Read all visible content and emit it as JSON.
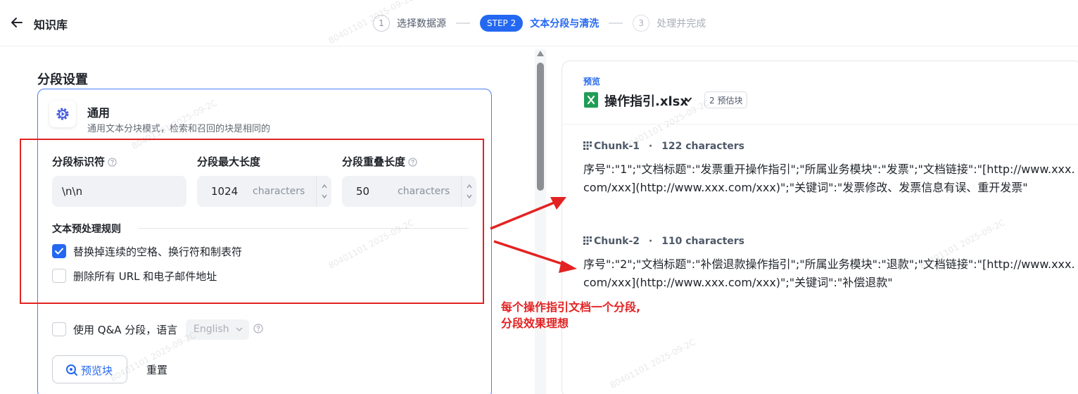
{
  "header": {
    "back_icon": "arrow-left-icon",
    "title": "知识库",
    "steps": [
      {
        "number": "1",
        "label": "选择数据源",
        "state": "done"
      },
      {
        "number": "STEP 2",
        "label": "文本分段与清洗",
        "state": "active"
      },
      {
        "number": "3",
        "label": "处理并完成",
        "state": "upcoming"
      }
    ]
  },
  "settings": {
    "title": "分段设置",
    "mode": {
      "name": "通用",
      "description": "通用文本分块模式，检索和召回的块是相同的",
      "icon": "gear-icon"
    },
    "fields": {
      "separator": {
        "label": "分段标识符",
        "value": "\\n\\n"
      },
      "max_length": {
        "label": "分段最大长度",
        "value": "1024",
        "unit": "characters"
      },
      "overlap": {
        "label": "分段重叠长度",
        "value": "50",
        "unit": "characters"
      }
    },
    "rules": {
      "title": "文本预处理规则",
      "items": [
        {
          "label": "替换掉连续的空格、换行符和制表符",
          "checked": true
        },
        {
          "label": "删除所有 URL 和电子邮件地址",
          "checked": false
        }
      ]
    },
    "qa": {
      "label": "使用 Q&A 分段，语言",
      "checked": false,
      "language": "English"
    },
    "preview_button": "预览块",
    "reset_button": "重置"
  },
  "preview": {
    "label": "预览",
    "file_name": "操作指引.xlsx",
    "badge": "2 预估块",
    "chunks": [
      {
        "title": "Chunk-1",
        "count": "122 characters",
        "text": "序号\":\"1\";\"文档标题\":\"发票重开操作指引\";\"所属业务模块\":\"发票\";\"文档链接\":\"[http://www.xxx.com/xxx](http://www.xxx.com/xxx)\";\"关键词\":\"发票修改、发票信息有误、重开发票\""
      },
      {
        "title": "Chunk-2",
        "count": "110 characters",
        "text": "序号\":\"2\";\"文档标题\":\"补偿退款操作指引\";\"所属业务模块\":\"退款\";\"文档链接\":\"[http://www.xxx.com/xxx](http://www.xxx.com/xxx)\";\"关键词\":\"补偿退款\""
      }
    ],
    "separator_dot": "·"
  },
  "annotation": {
    "line1": "每个操作指引文档一个分段,",
    "line2": "分段效果理想",
    "color": "#e32222"
  },
  "watermark": "80401101 2025-09-2C",
  "colors": {
    "accent": "#2468f2",
    "annotation": "#e32222"
  }
}
